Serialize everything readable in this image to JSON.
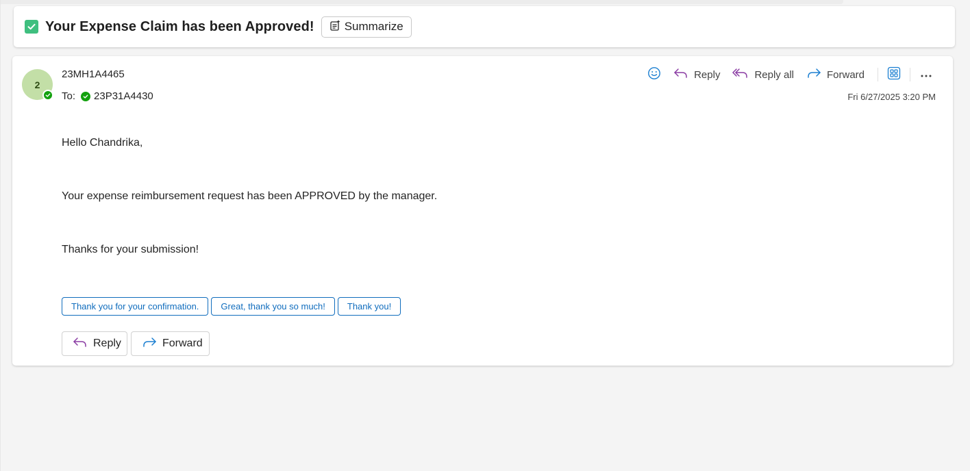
{
  "subject": {
    "title": "Your Expense Claim has been Approved!",
    "summarize_label": "Summarize"
  },
  "message": {
    "avatar_initial": "2",
    "sender": "23MH1A4465",
    "to_label": "To:",
    "recipient": "23P31A4430",
    "timestamp": "Fri 6/27/2025 3:20 PM",
    "actions": {
      "reply": "Reply",
      "reply_all": "Reply all",
      "forward": "Forward"
    },
    "body": {
      "greeting": "Hello Chandrika,",
      "line1": "Your expense reimbursement request has been APPROVED by the manager.",
      "line2": "Thanks for your submission!"
    },
    "quick_replies": [
      "Thank you for your confirmation.",
      "Great, thank you so much!",
      "Thank you!"
    ],
    "bottom_actions": {
      "reply": "Reply",
      "forward": "Forward"
    }
  },
  "colors": {
    "accent": "#0f6cbd",
    "reply_icon": "#8a3ca3",
    "forward_icon": "#1b7fd1",
    "presence": "#13a10e",
    "avatar_bg": "#c3dfa7",
    "check_icon": "#3fbf7f"
  },
  "icons": {
    "subject": "checkbox-checked-icon",
    "summarize": "summarize-sparkle-icon",
    "emoji": "smiley-icon",
    "reply": "reply-arrow-icon",
    "reply_all": "reply-all-arrow-icon",
    "forward": "forward-arrow-icon",
    "apps": "apps-grid-icon",
    "more": "more-ellipsis-icon",
    "presence": "available-check-icon"
  }
}
